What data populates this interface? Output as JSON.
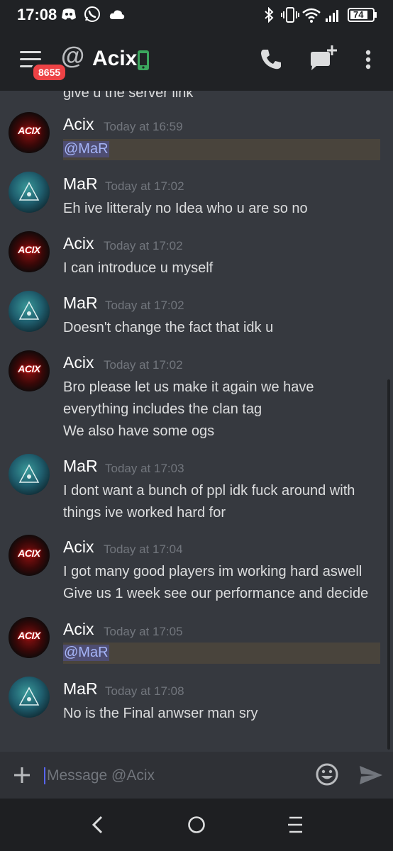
{
  "status_bar": {
    "time": "17:08",
    "battery": "74"
  },
  "header": {
    "badge_count": "8655",
    "channel_prefix": "@",
    "title": "Acix"
  },
  "partial_line": "give u the server link",
  "messages": [
    {
      "author": "Acix",
      "avatar": "ACIX",
      "time": "Today at 16:59",
      "mention": "@MaR",
      "lines": []
    },
    {
      "author": "MaR",
      "avatar": "mar",
      "time": "Today at 17:02",
      "lines": [
        "Eh ive litteraly no Idea who u are so no"
      ]
    },
    {
      "author": "Acix",
      "avatar": "ACIX",
      "time": "Today at 17:02",
      "lines": [
        "I can introduce u myself"
      ]
    },
    {
      "author": "MaR",
      "avatar": "mar",
      "time": "Today at 17:02",
      "lines": [
        "Doesn't change the fact that idk u"
      ]
    },
    {
      "author": "Acix",
      "avatar": "ACIX",
      "time": "Today at 17:02",
      "lines": [
        "Bro please let us make it again we have",
        "everything includes the clan tag",
        "We also have some ogs"
      ]
    },
    {
      "author": "MaR",
      "avatar": "mar",
      "time": "Today at 17:03",
      "lines": [
        "I dont want a bunch of ppl idk fuck around with",
        "things ive worked hard for"
      ]
    },
    {
      "author": "Acix",
      "avatar": "ACIX",
      "time": "Today at 17:04",
      "lines": [
        "I got many good players im working hard aswell",
        "Give us 1 week see our performance and decide"
      ]
    },
    {
      "author": "Acix",
      "avatar": "ACIX",
      "time": "Today at 17:05",
      "mention": "@MaR",
      "lines": []
    },
    {
      "author": "MaR",
      "avatar": "mar",
      "time": "Today at 17:08",
      "lines": [
        "No is the Final anwser man sry"
      ]
    }
  ],
  "composer": {
    "placeholder": "Message @Acix"
  },
  "colors": {
    "background": "#36393f",
    "header": "#202225",
    "badge": "#ed4245",
    "mention_text": "#a5b4f7",
    "mention_highlight": "#49443c",
    "online_green": "#3ba55d"
  },
  "icons": [
    "discord-icon",
    "whatsapp-icon",
    "cloud-icon",
    "bluetooth-icon",
    "vibrate-icon",
    "wifi-icon",
    "signal-icon",
    "battery-icon",
    "menu-icon",
    "mobile-online-icon",
    "call-icon",
    "new-group-dm-icon",
    "more-options-icon",
    "add-attachment-icon",
    "emoji-icon",
    "send-icon",
    "back-icon",
    "home-icon",
    "recents-icon"
  ]
}
